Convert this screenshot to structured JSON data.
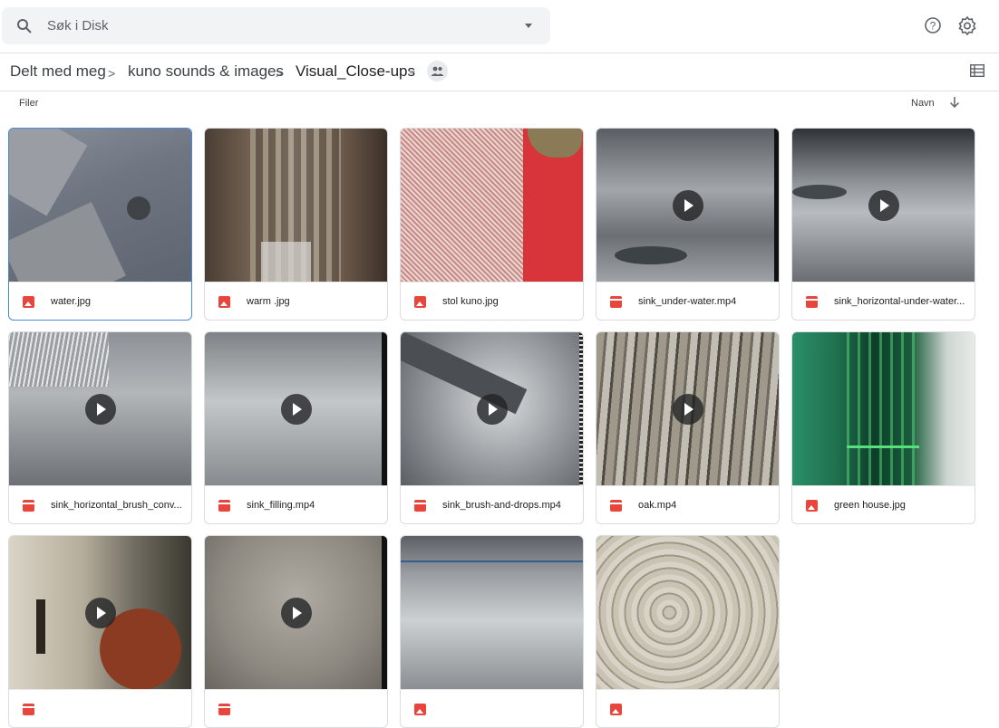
{
  "search": {
    "placeholder": "Søk i Disk"
  },
  "breadcrumb": {
    "items": [
      "Delt med meg",
      "kuno sounds & images",
      "Visual_Close-ups"
    ],
    "separator": ">"
  },
  "section": {
    "files_label": "Filer",
    "sort_label": "Navn"
  },
  "files": [
    {
      "name": "water.jpg",
      "type": "image"
    },
    {
      "name": "warm .jpg",
      "type": "image"
    },
    {
      "name": "stol kuno.jpg",
      "type": "image"
    },
    {
      "name": "sink_under-water.mp4",
      "type": "video"
    },
    {
      "name": "sink_horizontal-under-water...",
      "type": "video"
    },
    {
      "name": "sink_horizontal_brush_conv...",
      "type": "video"
    },
    {
      "name": "sink_filling.mp4",
      "type": "video"
    },
    {
      "name": "sink_brush-and-drops.mp4",
      "type": "video"
    },
    {
      "name": "oak.mp4",
      "type": "video"
    },
    {
      "name": "green house.jpg",
      "type": "image"
    },
    {
      "name": "",
      "type": "video"
    },
    {
      "name": "",
      "type": "video"
    },
    {
      "name": "",
      "type": "image"
    },
    {
      "name": "",
      "type": "image"
    }
  ],
  "colors": {
    "accent": "#4a88d9",
    "file_icon": "#e8453c"
  },
  "icons": [
    "search-icon",
    "help-icon",
    "settings-icon",
    "shared-people-icon",
    "list-view-icon",
    "sort-arrow-icon",
    "image-file-icon",
    "video-file-icon",
    "play-icon"
  ]
}
